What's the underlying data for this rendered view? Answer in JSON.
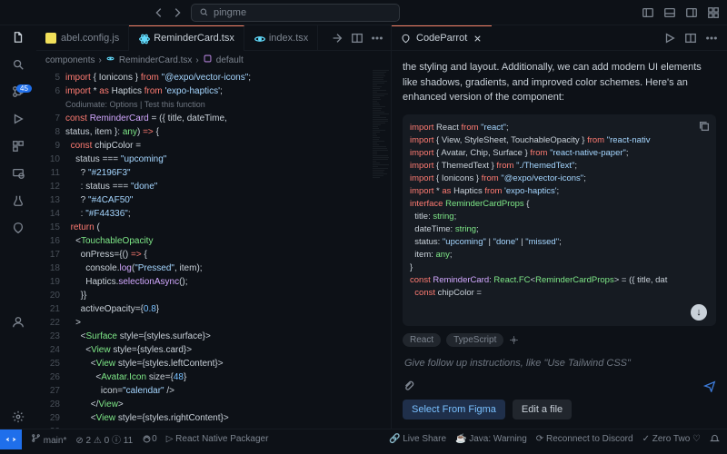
{
  "search": {
    "placeholder": "pingme"
  },
  "tabs": [
    {
      "label": "abel.config.js",
      "active": false
    },
    {
      "label": "ReminderCard.tsx",
      "active": true
    },
    {
      "label": "index.tsx",
      "active": false
    }
  ],
  "breadcrumb": {
    "folder": "components",
    "file": "ReminderCard.tsx",
    "symbol": "default"
  },
  "gutter_start": 5,
  "codelens": "Codiumate: Options | Test this function",
  "code_lines": [
    "<span class='kw'>import</span> <span class='pun'>{</span> <span class='var'>Ionicons</span> <span class='pun'>}</span> <span class='kw'>from</span> <span class='str'>\"@expo/vector-icons\"</span>;",
    "<span class='kw'>import</span> <span class='pun'>*</span> <span class='kw'>as</span> <span class='var'>Haptics</span> <span class='kw'>from</span> <span class='str'>'expo-haptics'</span>;",
    "",
    "<span class='kw'>const</span> <span class='fn'>ReminderCard</span> = <span class='pun'>({</span> <span class='var'>title</span>, <span class='var'>dateTime</span>,",
    "<span class='var'>status</span>, <span class='var'>item</span> <span class='pun'>}:</span> <span class='type'>any</span><span class='pun'>)</span> <span class='kw'>=></span> <span class='pun'>{</span>",
    "  <span class='kw'>const</span> <span class='var'>chipColor</span> =",
    "    <span class='var'>status</span> === <span class='str'>\"upcoming\"</span>",
    "      ? <span class='str'>\"#2196F3\"</span>",
    "      : <span class='var'>status</span> === <span class='str'>\"done\"</span>",
    "      ? <span class='str'>\"#4CAF50\"</span>",
    "      : <span class='str'>\"#F44336\"</span>;",
    "",
    "  <span class='kw'>return</span> <span class='pun'>(</span>",
    "    <span class='pun'>&lt;</span><span class='tag'>TouchableOpacity</span>",
    "      <span class='var'>onPress</span>=<span class='pun'>{()</span> <span class='kw'>=></span> <span class='pun'>{</span>",
    "        <span class='var'>console</span>.<span class='fn'>log</span>(<span class='str'>\"Pressed\"</span>, <span class='var'>item</span>);",
    "        <span class='var'>Haptics</span>.<span class='fn'>selectionAsync</span>();",
    "      <span class='pun'>}}</span>",
    "      <span class='var'>activeOpacity</span>=<span class='pun'>{</span><span class='num'>0.8</span><span class='pun'>}</span>",
    "    <span class='pun'>&gt;</span>",
    "      <span class='pun'>&lt;</span><span class='tag'>Surface</span> <span class='var'>style</span>=<span class='pun'>{</span><span class='var'>styles.surface</span><span class='pun'>}&gt;</span>",
    "        <span class='pun'>&lt;</span><span class='tag'>View</span> <span class='var'>style</span>=<span class='pun'>{</span><span class='var'>styles.card</span><span class='pun'>}&gt;</span>",
    "          <span class='pun'>&lt;</span><span class='tag'>View</span> <span class='var'>style</span>=<span class='pun'>{</span><span class='var'>styles.leftContent</span><span class='pun'>}&gt;</span>",
    "            <span class='pun'>&lt;</span><span class='tag'>Avatar.Icon</span> <span class='var'>size</span>=<span class='pun'>{</span><span class='num'>48</span><span class='pun'>}</span>",
    "              <span class='var'>icon</span>=<span class='str'>\"calendar\"</span> <span class='pun'>/&gt;</span>",
    "          <span class='pun'>&lt;/</span><span class='tag'>View</span><span class='pun'>&gt;</span>",
    "          <span class='pun'>&lt;</span><span class='tag'>View</span> <span class='var'>style</span>=<span class='pun'>{</span><span class='var'>styles.rightContent</span><span class='pun'>}&gt;</span>"
  ],
  "panel": {
    "title": "CodeParrot",
    "desc": "the styling and layout. Additionally, we can add modern UI elements like shadows, gradients, and improved color schemes. Here's an enhanced version of the component:",
    "snippet_lines": [
      "<span class='kw'>import</span> <span class='var'>React</span> <span class='kw'>from</span> <span class='str'>\"react\"</span>;",
      "<span class='kw'>import</span> { <span class='var'>View</span>, <span class='var'>StyleSheet</span>, <span class='var'>TouchableOpacity</span> } <span class='kw'>from</span> <span class='str'>\"react-nativ</span>",
      "<span class='kw'>import</span> { <span class='var'>Avatar</span>, <span class='var'>Chip</span>, <span class='var'>Surface</span> } <span class='kw'>from</span> <span class='str'>\"react-native-paper\"</span>;",
      "<span class='kw'>import</span> { <span class='var'>ThemedText</span> } <span class='kw'>from</span> <span class='str'>\"./ThemedText\"</span>;",
      "<span class='kw'>import</span> { <span class='var'>Ionicons</span> } <span class='kw'>from</span> <span class='str'>\"@expo/vector-icons\"</span>;",
      "<span class='kw'>import</span> * <span class='kw'>as</span> <span class='var'>Haptics</span> <span class='kw'>from</span> <span class='str'>'expo-haptics'</span>;",
      "",
      "<span class='kw'>interface</span> <span class='type'>ReminderCardProps</span> {",
      "  <span class='var'>title</span>: <span class='type'>string</span>;",
      "  <span class='var'>dateTime</span>: <span class='type'>string</span>;",
      "  <span class='var'>status</span>: <span class='str'>\"upcoming\"</span> | <span class='str'>\"done\"</span> | <span class='str'>\"missed\"</span>;",
      "  <span class='var'>item</span>: <span class='type'>any</span>;",
      "}",
      "",
      "<span class='kw'>const</span> <span class='fn'>ReminderCard</span>: <span class='type'>React.FC</span>&lt;<span class='type'>ReminderCardProps</span>&gt; = ({ <span class='var'>title</span>, <span class='var'>dat</span>",
      "  <span class='kw'>const</span> <span class='var'>chipColor</span> ="
    ],
    "chips": [
      "React",
      "TypeScript"
    ],
    "followup_placeholder": "Give follow up instructions, like \"Use Tailwind CSS\"",
    "btn_primary": "Select From Figma",
    "btn_secondary": "Edit a file"
  },
  "statusbar": {
    "branch": "main*",
    "errors": "2",
    "warnings": "0",
    "info": "11",
    "port": "0",
    "packager": "React Native Packager",
    "right": [
      "Live Share",
      "Java: Warning",
      "Reconnect to Discord",
      "Zero Two"
    ]
  },
  "badge": "45"
}
